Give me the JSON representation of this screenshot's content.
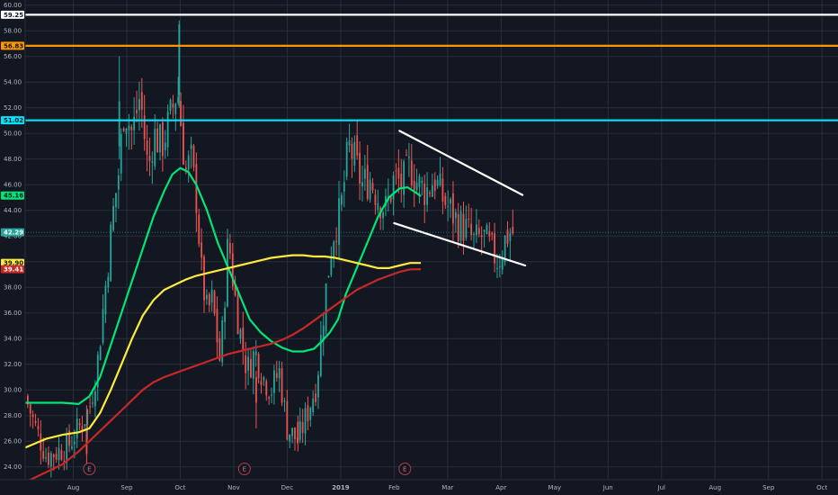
{
  "theme": {
    "background": "#131722",
    "grid": "#2a2e39",
    "up": "#26a69a",
    "down": "#ef5350",
    "axis_text": "#b2b5be"
  },
  "chart_data": {
    "type": "candlestick",
    "ylim": [
      23.0,
      60.4
    ],
    "y_ticks": [
      "24.00",
      "26.00",
      "28.00",
      "30.00",
      "32.00",
      "34.00",
      "36.00",
      "38.00",
      "40.00",
      "42.00",
      "44.00",
      "46.00",
      "48.00",
      "50.00",
      "52.00",
      "54.00",
      "56.00",
      "58.00",
      "60.00"
    ],
    "x_labels": [
      "Aug",
      "Sep",
      "Oct",
      "Nov",
      "Dec",
      "2019",
      "Feb",
      "Mar",
      "Apr",
      "May",
      "Jun",
      "Jul",
      "Aug",
      "Sep",
      "Oct"
    ],
    "x_label_months": [
      0.5,
      1.5,
      2.5,
      3.5,
      4.5,
      5.5,
      6.5,
      7.5,
      8.5,
      9.5,
      10.5,
      11.5,
      12.5,
      13.5,
      14.5
    ],
    "x_grid_months": [
      0.5,
      1.5,
      2.5,
      3.5,
      4.5,
      5.5,
      6.5,
      7.5,
      8.5,
      9.5,
      10.5,
      11.5,
      12.5,
      13.5,
      14.5
    ],
    "xlim_months": [
      -0.4,
      14.8
    ],
    "last_month": 8.72,
    "candle_months_per_bar": 0.0485,
    "close_anchors": [
      [
        -0.4,
        29.5
      ],
      [
        -0.2,
        27.0
      ],
      [
        0.0,
        24.8
      ],
      [
        0.2,
        25.2
      ],
      [
        0.4,
        25.6
      ],
      [
        0.6,
        27.0
      ],
      [
        0.8,
        28.5
      ],
      [
        0.95,
        32.0
      ],
      [
        1.1,
        38.0
      ],
      [
        1.25,
        44.0
      ],
      [
        1.35,
        47.0
      ],
      [
        1.45,
        52.0
      ],
      [
        1.6,
        50.0
      ],
      [
        1.75,
        53.0
      ],
      [
        1.9,
        47.0
      ],
      [
        2.0,
        50.0
      ],
      [
        2.15,
        49.0
      ],
      [
        2.3,
        51.0
      ],
      [
        2.45,
        53.5
      ],
      [
        2.6,
        47.0
      ],
      [
        2.7,
        48.0
      ],
      [
        2.8,
        45.0
      ],
      [
        2.9,
        39.0
      ],
      [
        3.0,
        36.0
      ],
      [
        3.1,
        37.0
      ],
      [
        3.25,
        32.0
      ],
      [
        3.4,
        42.0
      ],
      [
        3.5,
        38.0
      ],
      [
        3.6,
        35.0
      ],
      [
        3.75,
        31.5
      ],
      [
        3.9,
        33.0
      ],
      [
        4.05,
        31.0
      ],
      [
        4.2,
        30.0
      ],
      [
        4.35,
        31.5
      ],
      [
        4.5,
        27.0
      ],
      [
        4.7,
        26.0
      ],
      [
        4.9,
        28.5
      ],
      [
        5.05,
        30.5
      ],
      [
        5.2,
        37.0
      ],
      [
        5.35,
        42.0
      ],
      [
        5.5,
        44.0
      ],
      [
        5.65,
        49.0
      ],
      [
        5.75,
        48.0
      ],
      [
        5.9,
        46.0
      ],
      [
        6.05,
        46.5
      ],
      [
        6.2,
        45.0
      ],
      [
        6.35,
        44.0
      ],
      [
        6.5,
        46.5
      ],
      [
        6.65,
        46.0
      ],
      [
        6.8,
        47.5
      ],
      [
        6.95,
        46.0
      ],
      [
        7.1,
        45.5
      ],
      [
        7.25,
        46.5
      ],
      [
        7.4,
        45.0
      ],
      [
        7.55,
        44.0
      ],
      [
        7.7,
        43.0
      ],
      [
        7.85,
        42.5
      ],
      [
        8.0,
        41.5
      ],
      [
        8.15,
        42.0
      ],
      [
        8.3,
        41.0
      ],
      [
        8.45,
        40.0
      ],
      [
        8.55,
        41.5
      ],
      [
        8.65,
        42.3
      ],
      [
        8.72,
        42.29
      ]
    ],
    "ma_series": [
      {
        "color": "#00e676",
        "line_width": 2.2,
        "points": [
          [
            -0.4,
            29.0
          ],
          [
            0.0,
            29.0
          ],
          [
            0.3,
            29.0
          ],
          [
            0.6,
            28.9
          ],
          [
            0.8,
            29.5
          ],
          [
            1.0,
            31.0
          ],
          [
            1.2,
            33.5
          ],
          [
            1.4,
            36.0
          ],
          [
            1.6,
            38.5
          ],
          [
            1.8,
            41.0
          ],
          [
            2.0,
            43.5
          ],
          [
            2.2,
            45.5
          ],
          [
            2.35,
            46.8
          ],
          [
            2.5,
            47.3
          ],
          [
            2.65,
            47.0
          ],
          [
            2.8,
            46.0
          ],
          [
            3.0,
            44.0
          ],
          [
            3.2,
            41.5
          ],
          [
            3.4,
            39.5
          ],
          [
            3.6,
            37.5
          ],
          [
            3.8,
            35.5
          ],
          [
            4.0,
            34.5
          ],
          [
            4.2,
            33.8
          ],
          [
            4.4,
            33.3
          ],
          [
            4.6,
            33.0
          ],
          [
            4.8,
            33.0
          ],
          [
            5.0,
            33.2
          ],
          [
            5.15,
            33.8
          ],
          [
            5.3,
            34.5
          ],
          [
            5.45,
            35.5
          ],
          [
            5.6,
            37.5
          ],
          [
            5.8,
            39.5
          ],
          [
            6.0,
            41.5
          ],
          [
            6.2,
            43.5
          ],
          [
            6.4,
            45.0
          ],
          [
            6.6,
            45.7
          ],
          [
            6.75,
            45.8
          ],
          [
            6.9,
            45.4
          ],
          [
            7.0,
            45.1
          ]
        ]
      },
      {
        "color": "#ffeb3b",
        "line_width": 2.2,
        "points": [
          [
            -0.4,
            25.5
          ],
          [
            0.0,
            26.2
          ],
          [
            0.3,
            26.5
          ],
          [
            0.6,
            26.7
          ],
          [
            0.8,
            27.0
          ],
          [
            1.0,
            28.2
          ],
          [
            1.2,
            30.0
          ],
          [
            1.4,
            32.0
          ],
          [
            1.6,
            34.0
          ],
          [
            1.8,
            35.8
          ],
          [
            2.0,
            37.0
          ],
          [
            2.2,
            37.8
          ],
          [
            2.4,
            38.2
          ],
          [
            2.6,
            38.6
          ],
          [
            2.8,
            38.9
          ],
          [
            3.0,
            39.1
          ],
          [
            3.2,
            39.3
          ],
          [
            3.4,
            39.5
          ],
          [
            3.6,
            39.7
          ],
          [
            3.8,
            39.9
          ],
          [
            4.0,
            40.1
          ],
          [
            4.2,
            40.3
          ],
          [
            4.4,
            40.4
          ],
          [
            4.6,
            40.5
          ],
          [
            4.8,
            40.5
          ],
          [
            5.0,
            40.4
          ],
          [
            5.2,
            40.4
          ],
          [
            5.4,
            40.3
          ],
          [
            5.6,
            40.1
          ],
          [
            5.8,
            39.9
          ],
          [
            6.0,
            39.7
          ],
          [
            6.2,
            39.5
          ],
          [
            6.4,
            39.5
          ],
          [
            6.6,
            39.7
          ],
          [
            6.8,
            39.9
          ],
          [
            7.0,
            39.9
          ]
        ]
      },
      {
        "color": "#c62828",
        "line_width": 2.2,
        "points": [
          [
            -0.4,
            22.8
          ],
          [
            0.0,
            23.6
          ],
          [
            0.3,
            24.2
          ],
          [
            0.6,
            25.2
          ],
          [
            0.8,
            26.0
          ],
          [
            1.0,
            26.8
          ],
          [
            1.2,
            27.6
          ],
          [
            1.4,
            28.4
          ],
          [
            1.6,
            29.2
          ],
          [
            1.8,
            30.0
          ],
          [
            2.0,
            30.6
          ],
          [
            2.2,
            31.0
          ],
          [
            2.4,
            31.3
          ],
          [
            2.6,
            31.6
          ],
          [
            2.8,
            31.9
          ],
          [
            3.0,
            32.2
          ],
          [
            3.2,
            32.5
          ],
          [
            3.4,
            32.8
          ],
          [
            3.6,
            33.0
          ],
          [
            3.8,
            33.2
          ],
          [
            4.0,
            33.4
          ],
          [
            4.2,
            33.6
          ],
          [
            4.4,
            33.9
          ],
          [
            4.6,
            34.3
          ],
          [
            4.8,
            34.8
          ],
          [
            5.0,
            35.4
          ],
          [
            5.2,
            36.0
          ],
          [
            5.4,
            36.6
          ],
          [
            5.6,
            37.2
          ],
          [
            5.8,
            37.8
          ],
          [
            6.0,
            38.2
          ],
          [
            6.2,
            38.6
          ],
          [
            6.4,
            38.9
          ],
          [
            6.6,
            39.2
          ],
          [
            6.8,
            39.4
          ],
          [
            7.0,
            39.41
          ]
        ]
      }
    ],
    "horizontal_lines": [
      {
        "value": 59.25,
        "color": "#ffffff",
        "label": "59.25",
        "label_bg": "#ffffff",
        "label_fg": "#131722"
      },
      {
        "value": 56.83,
        "color": "#ff9800",
        "label": "56.83",
        "label_bg": "#ff9800",
        "label_fg": "#131722"
      },
      {
        "value": 51.02,
        "color": "#00e5ff",
        "label": "51.02",
        "label_bg": "#00e5ff",
        "label_fg": "#131722"
      }
    ],
    "price_badges": [
      {
        "value": 45.16,
        "label": "45.16",
        "bg": "#00e676",
        "fg": "#131722"
      },
      {
        "value": 42.29,
        "label": "42.29",
        "bg": "#26a69a",
        "fg": "#ffffff"
      },
      {
        "value": 39.9,
        "label": "39.90",
        "bg": "#ffeb3b",
        "fg": "#131722"
      },
      {
        "value": 39.41,
        "label": "39.41",
        "bg": "#c62828",
        "fg": "#ffffff"
      }
    ],
    "trendlines": [
      {
        "from": [
          6.6,
          50.2
        ],
        "to": [
          8.9,
          45.2
        ],
        "color": "#ffffff"
      },
      {
        "from": [
          6.5,
          43.0
        ],
        "to": [
          8.95,
          39.7
        ],
        "color": "#ffffff"
      }
    ],
    "earnings_markers": [
      {
        "month": 0.8,
        "label": "E"
      },
      {
        "month": 3.7,
        "label": "E"
      },
      {
        "month": 6.7,
        "label": "E"
      }
    ],
    "extra_candles": [
      {
        "month": 2.48,
        "open": 53.0,
        "close": 58.5,
        "high": 58.8,
        "low": 52.0
      },
      {
        "month": 1.36,
        "open": 49.0,
        "close": 52.5,
        "high": 56.0,
        "low": 48.0
      },
      {
        "month": 3.92,
        "open": 31.0,
        "close": 29.0,
        "high": 31.5,
        "low": 27.0
      },
      {
        "month": 4.7,
        "open": 27.5,
        "close": 26.0,
        "high": 28.0,
        "low": 25.2
      },
      {
        "month": 0.75,
        "open": 27.0,
        "close": 25.0,
        "high": 28.8,
        "low": 24.2
      }
    ]
  }
}
